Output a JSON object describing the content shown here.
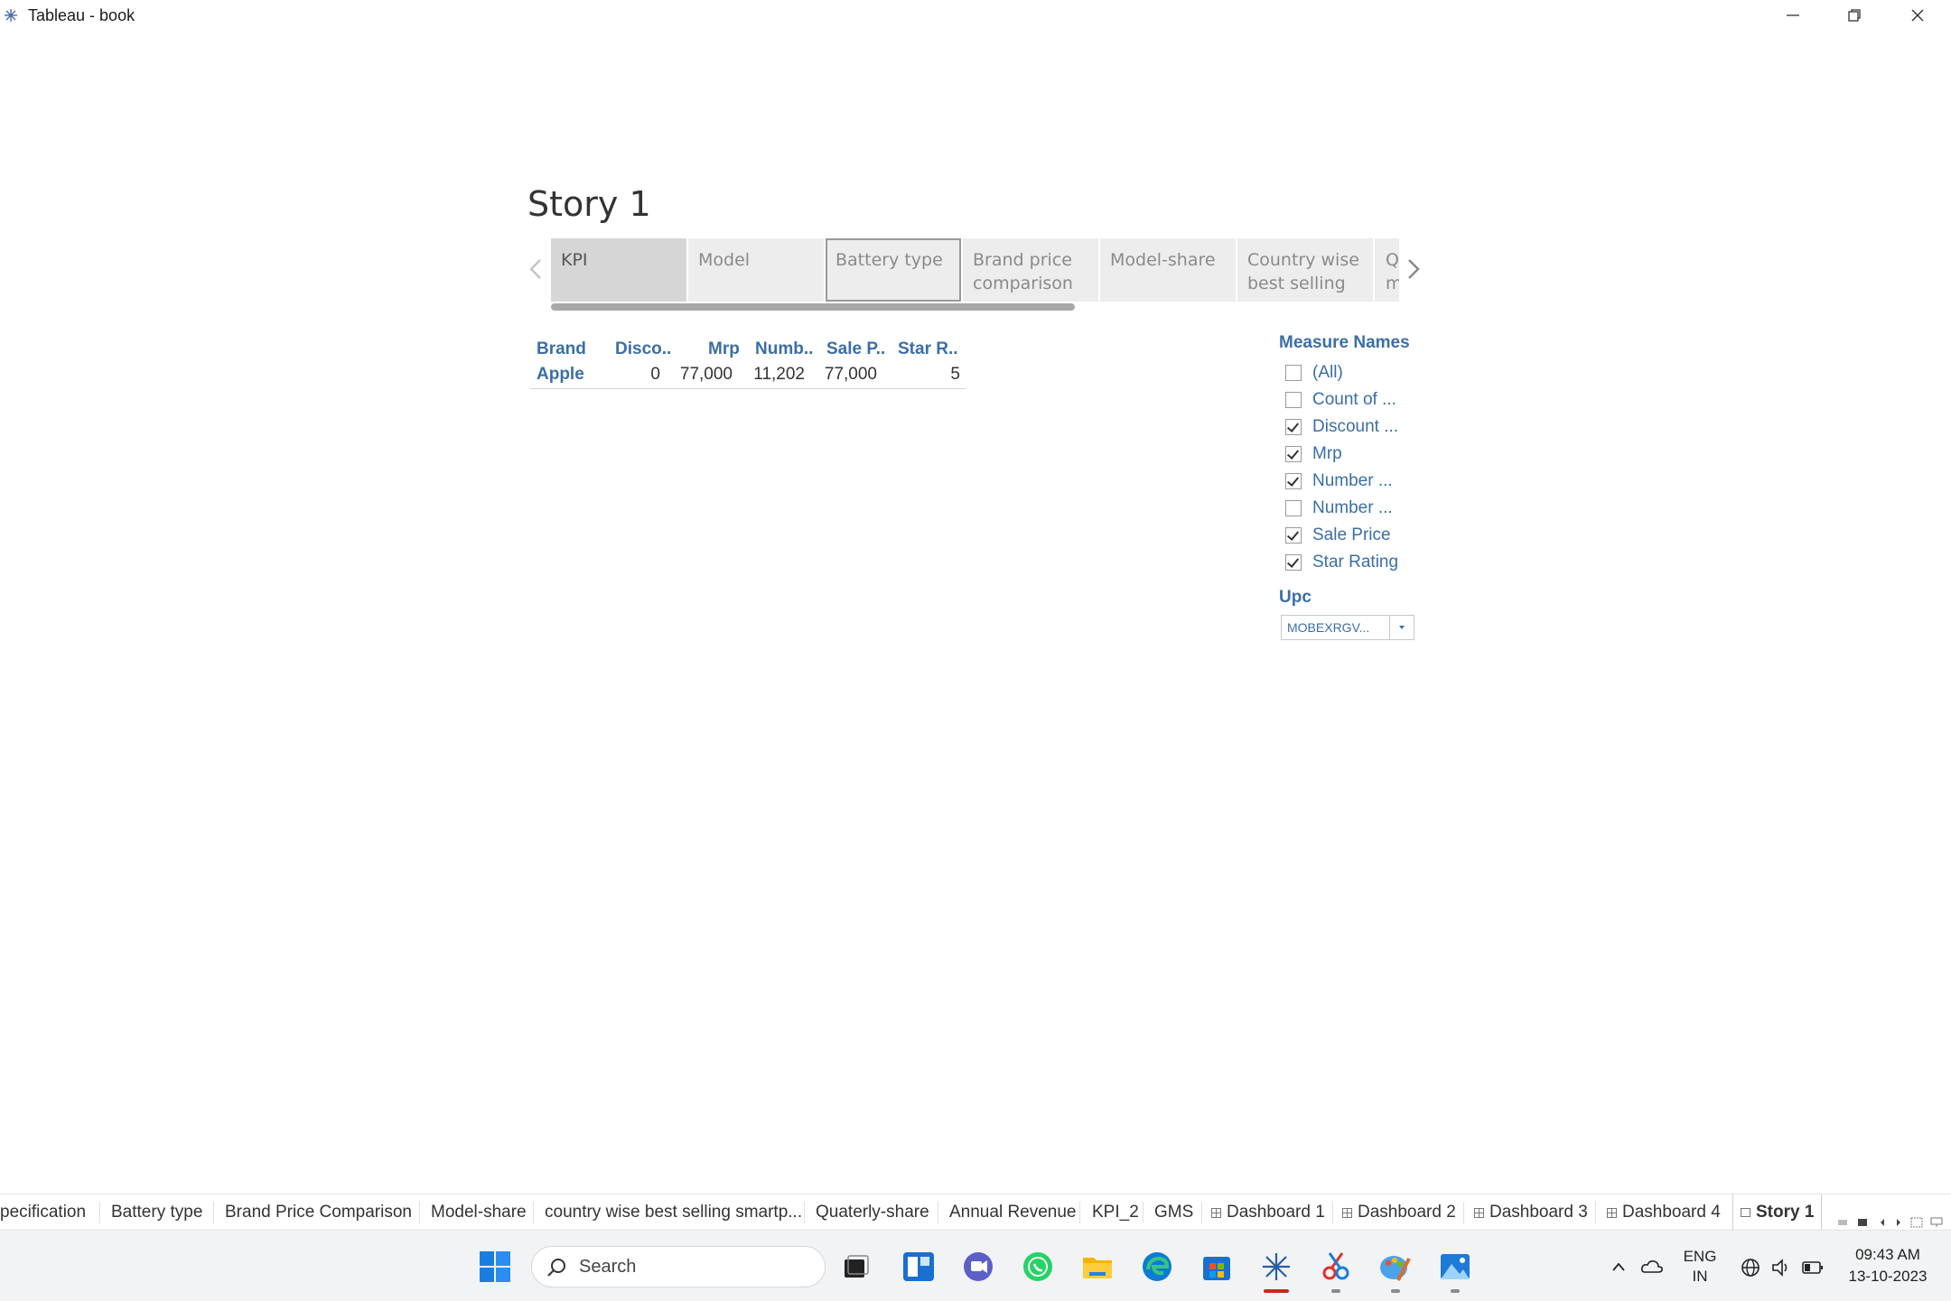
{
  "window": {
    "title": "Tableau - book",
    "minimize_icon": "minimize-icon",
    "restore_icon": "restore-icon",
    "close_icon": "close-icon"
  },
  "story": {
    "title": "Story 1",
    "tabs": [
      {
        "label": "KPI",
        "state": "active"
      },
      {
        "label": "Model",
        "state": "normal"
      },
      {
        "label": "Battery type",
        "state": "outlined"
      },
      {
        "label": "Brand price comparison",
        "state": "normal"
      },
      {
        "label": "Model-share",
        "state": "normal"
      },
      {
        "label": "Country wise best selling",
        "state": "normal"
      },
      {
        "label": "Qu m",
        "state": "normal"
      }
    ]
  },
  "kpi_table": {
    "headers": [
      "Brand",
      "Disco..",
      "Mrp",
      "Numb..",
      "Sale P..",
      "Star R.."
    ],
    "row": {
      "brand": "Apple",
      "discount": "0",
      "mrp": "77,000",
      "number": "11,202",
      "sale_price": "77,000",
      "star_rating": "5"
    }
  },
  "filters": {
    "measure_names": {
      "title": "Measure Names",
      "items": [
        {
          "label": "(All)",
          "checked": false
        },
        {
          "label": "Count of ...",
          "checked": false
        },
        {
          "label": "Discount ...",
          "checked": true
        },
        {
          "label": "Mrp",
          "checked": true
        },
        {
          "label": "Number ...",
          "checked": true
        },
        {
          "label": "Number ...",
          "checked": false
        },
        {
          "label": "Sale Price",
          "checked": true
        },
        {
          "label": "Star Rating",
          "checked": true
        }
      ]
    },
    "upc": {
      "title": "Upc",
      "selected": "MOBEXRGV..."
    }
  },
  "sheet_tabs": [
    {
      "label": "pecification",
      "type": "sheet"
    },
    {
      "label": "Battery type",
      "type": "sheet"
    },
    {
      "label": "Brand Price Comparison",
      "type": "sheet"
    },
    {
      "label": "Model-share",
      "type": "sheet"
    },
    {
      "label": "country wise best selling smartp...",
      "type": "sheet"
    },
    {
      "label": "Quaterly-share",
      "type": "sheet"
    },
    {
      "label": "Annual Revenue",
      "type": "sheet"
    },
    {
      "label": "KPI_2",
      "type": "sheet"
    },
    {
      "label": "GMS",
      "type": "sheet"
    },
    {
      "label": "Dashboard 1",
      "type": "dashboard"
    },
    {
      "label": "Dashboard 2",
      "type": "dashboard"
    },
    {
      "label": "Dashboard 3",
      "type": "dashboard"
    },
    {
      "label": "Dashboard 4",
      "type": "dashboard"
    },
    {
      "label": "Story 1",
      "type": "story",
      "active": true
    }
  ],
  "taskbar": {
    "search_placeholder": "Search",
    "apps": [
      "windows-start-icon",
      "task-view-icon",
      "widgets-icon",
      "teams-chat-icon",
      "whatsapp-icon",
      "file-explorer-icon",
      "edge-icon",
      "store-icon",
      "tableau-icon",
      "snipping-tool-icon",
      "paint-icon",
      "photos-icon"
    ],
    "tray": {
      "language_top": "ENG",
      "language_bottom": "IN",
      "time": "09:43 AM",
      "date": "13-10-2023"
    }
  },
  "colors": {
    "accent_blue": "#3b6ea5",
    "tab_active": "#d6d6d6",
    "tab_inactive": "#ededed",
    "taskbar_bg": "#f2f3f5",
    "running_indicator": "#c42b1c"
  }
}
